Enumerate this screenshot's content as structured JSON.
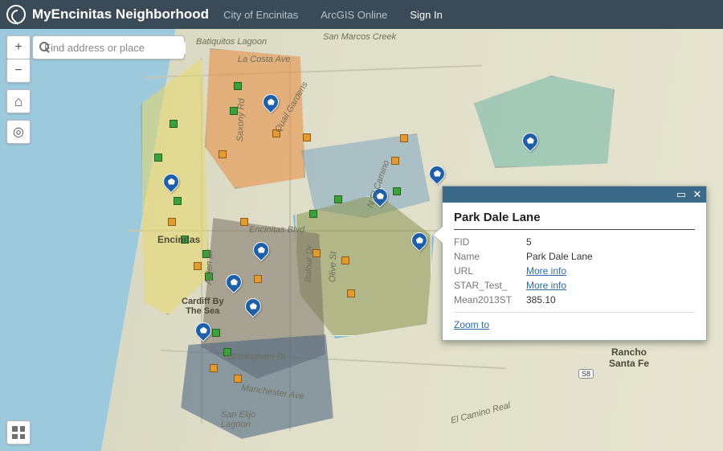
{
  "header": {
    "app_title": "MyEncinitas Neighborhood",
    "org_label": "City of Encinitas",
    "portal_label": "ArcGIS Online",
    "signin_label": "Sign In"
  },
  "search": {
    "placeholder": "Find address or place"
  },
  "tools": {
    "zoom_in": "+",
    "zoom_out": "−",
    "home": "⌂",
    "locate": "◎"
  },
  "popup": {
    "title": "Park Dale Lane",
    "rows": [
      {
        "k": "FID",
        "v": "5"
      },
      {
        "k": "Name",
        "v": "Park Dale Lane"
      },
      {
        "k": "URL",
        "v": "More info",
        "link": true
      },
      {
        "k": "STAR_Test_",
        "v": "More info",
        "link": true
      },
      {
        "k": "Mean2013ST",
        "v": "385.10"
      }
    ],
    "zoom_to": "Zoom to"
  },
  "labels": {
    "encinitas": "Encinitas",
    "cardiff": "Cardiff By\nThe Sea",
    "rancho": "Rancho\nSanta Fe",
    "batiquitos": "Batiquitos Lagoon",
    "sanelijo": "San Elijo\nLagoon",
    "lacosta": "La Costa Ave",
    "sanmarcos": "San Marcos Creek",
    "elcamino": "El Camino Real",
    "birmingham": "Birmingham Dr",
    "manchester": "Manchester Ave",
    "saxony": "Saxony Rd",
    "quail": "Quail Gardens",
    "arden": "Arden Dr",
    "balour": "Balour Dr",
    "olive": "Olive St",
    "encinitasblvd": "Encinitas Blvd",
    "n_elcamino": "N El Camino"
  },
  "routes": {
    "s8": "S8"
  }
}
